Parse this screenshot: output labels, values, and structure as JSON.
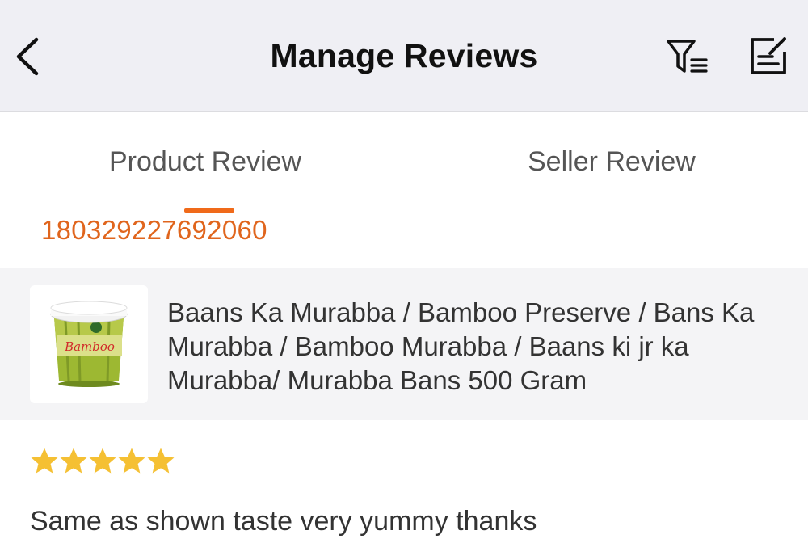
{
  "header": {
    "title": "Manage Reviews",
    "back_icon": "chevron-left-icon",
    "filter_icon": "filter-list-icon",
    "edit_icon": "edit-note-icon"
  },
  "tabs": [
    {
      "label": "Product Review",
      "active": true
    },
    {
      "label": "Seller Review",
      "active": false
    }
  ],
  "order": {
    "id": "180329227692060"
  },
  "product": {
    "name": "Baans Ka Murabba / Bamboo Preserve / Bans Ka Murabba / Bamboo Murabba / Baans ki jr ka Murabba/ Murabba Bans 500 Gram",
    "thumbnail_label": "Bamboo"
  },
  "review": {
    "rating": 5,
    "max_rating": 5,
    "text": "Same as shown taste very yummy thanks"
  },
  "colors": {
    "accent": "#f06a1a",
    "order_id": "#e0651d",
    "star": "#f5c033"
  }
}
